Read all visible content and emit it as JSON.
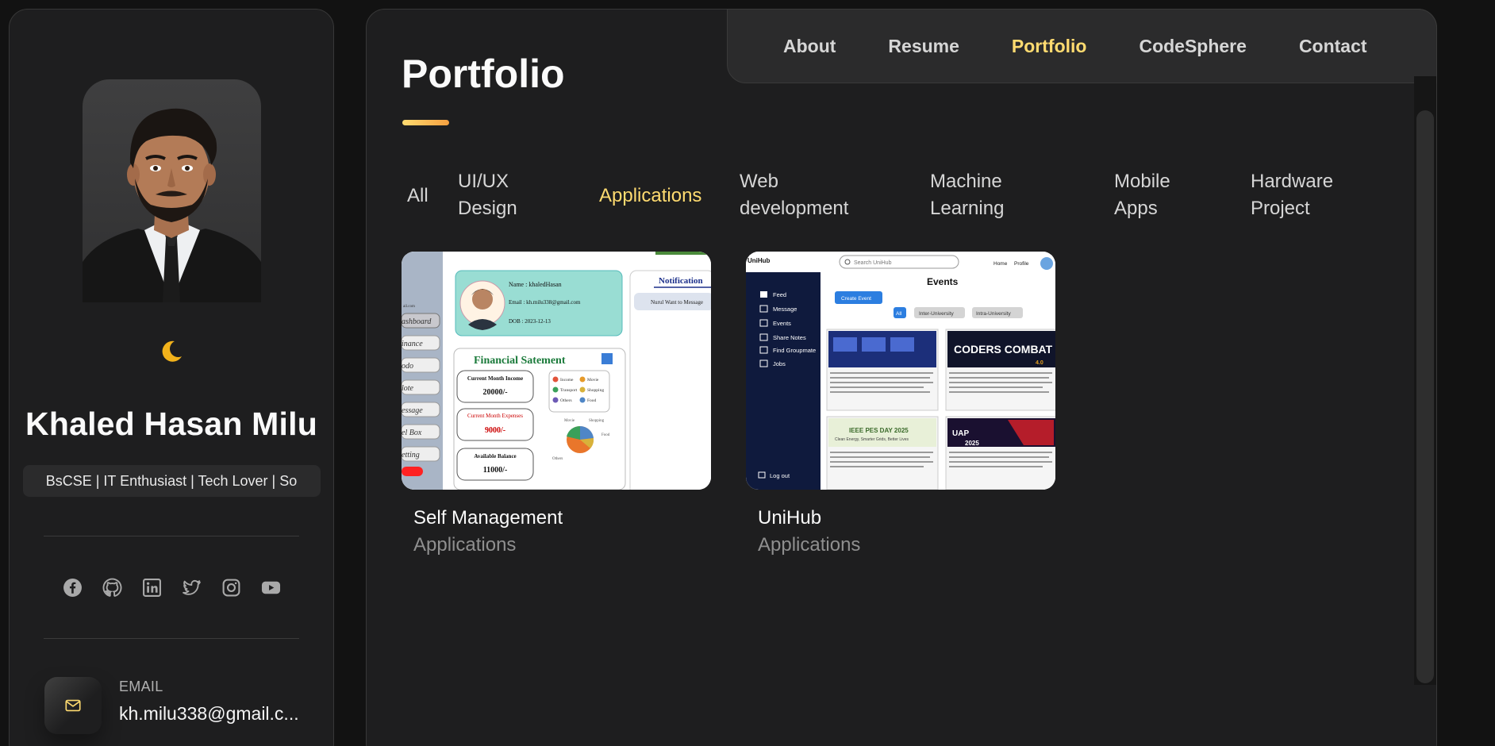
{
  "colors": {
    "accent": "#ffdb70",
    "background": "#121212",
    "panel": "#1e1e1f"
  },
  "sidebar": {
    "name": "Khaled Hasan Milu",
    "title": "BsCSE | IT Enthusiast | Tech Lover | So",
    "theme_icon": "moon-icon",
    "socials": [
      {
        "icon": "facebook-icon"
      },
      {
        "icon": "github-icon"
      },
      {
        "icon": "linkedin-icon"
      },
      {
        "icon": "twitter-icon"
      },
      {
        "icon": "instagram-icon"
      },
      {
        "icon": "youtube-icon"
      }
    ],
    "contact": {
      "icon": "mail-icon",
      "label": "EMAIL",
      "value": "kh.milu338@gmail.c..."
    }
  },
  "navbar": {
    "items": [
      "About",
      "Resume",
      "Portfolio",
      "CodeSphere",
      "Contact"
    ],
    "active": "Portfolio"
  },
  "page": {
    "title": "Portfolio"
  },
  "filters": {
    "items": [
      [
        "All"
      ],
      [
        "UI/UX",
        "Design"
      ],
      [
        "Applications"
      ],
      [
        "Web",
        "development"
      ],
      [
        "Machine",
        "Learning"
      ],
      [
        "Mobile",
        "Apps"
      ],
      [
        "Hardware",
        "Project"
      ]
    ],
    "active": "Applications"
  },
  "projects": [
    {
      "title": "Self Management",
      "category": "Applications",
      "screenshot": {
        "profile": {
          "name": "Name : khaledHasan",
          "email": "Email : kh.milu338@gmail.com",
          "dob": "DOB : 2023-12-13"
        },
        "notification_title": "Notification",
        "notification_item": "Nurul Want to Message",
        "menu": [
          "ashboard",
          "inance",
          "odo",
          "lote",
          "essage",
          "el Box",
          "etting"
        ],
        "menu_header": "ail.com",
        "financial_title": "Financial Satement",
        "income_label": "Current Month Income",
        "income_value": "20000/-",
        "expense_label": "Current Month Expenses",
        "expense_value": "9000/-",
        "balance_label": "Available Balance",
        "balance_value": "11000/-",
        "legend": [
          "Income",
          "Movie",
          "Transport",
          "Shopping",
          "Others",
          "Food"
        ],
        "pie_labels": [
          "Movie",
          "Shopping",
          "Food",
          "Others"
        ]
      }
    },
    {
      "title": "UniHub",
      "category": "Applications",
      "screenshot": {
        "logo": "UniHub",
        "search_placeholder": "Search UniHub",
        "top_links": [
          "Home",
          "Profile"
        ],
        "menu": [
          "Feed",
          "Message",
          "Events",
          "Share Notes",
          "Find Groupmate",
          "Jobs"
        ],
        "logout": "Log out",
        "heading": "Events",
        "create_button": "Create Event",
        "filters": [
          "All",
          "Inter-University",
          "Intra-University"
        ],
        "banner_1": "CODERS COMBAT",
        "banner_1_sub": "4.0",
        "banner_2": "IEEE PES DAY 2025",
        "banner_2_sub": "Clean Energy, Smarter Grids, Better Lives",
        "banner_3": "UAP",
        "banner_3_sub": "2025"
      }
    }
  ]
}
